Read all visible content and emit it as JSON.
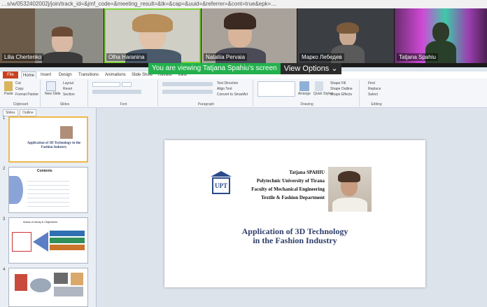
{
  "browser": {
    "url": "…s/w/0532402002j/join/track_id=&jmf_code=&meeting_result=&tk=&cap=&uuid=&referrer=&cont=true&epk=…"
  },
  "gallery": {
    "participants": [
      {
        "name": "Lilia Chertenko"
      },
      {
        "name": "Olha Haranina"
      },
      {
        "name": "Nataliia Pervaia"
      },
      {
        "name": "Марко Лебедев"
      },
      {
        "name": "Tatjana Spahiu"
      }
    ]
  },
  "share_banner": {
    "message": "You are viewing Tatjana Spahiu's screen",
    "options_label": "View Options"
  },
  "ribbon": {
    "file_tab": "File",
    "tabs": [
      "Home",
      "Insert",
      "Design",
      "Transitions",
      "Animations",
      "Slide Show",
      "Review",
      "View"
    ],
    "groups": [
      "Clipboard",
      "Slides",
      "Font",
      "Paragraph",
      "Drawing",
      "Editing"
    ],
    "clipboard": {
      "paste": "Paste",
      "cut": "Cut",
      "copy": "Copy",
      "format_painter": "Format Painter"
    },
    "slides": {
      "new_slide": "New Slide",
      "layout": "Layout",
      "reset": "Reset",
      "section": "Section"
    },
    "paragraph": {
      "text_direction": "Text Direction",
      "align_text": "Align Text",
      "convert": "Convert to SmartArt"
    },
    "drawing": {
      "arrange": "Arrange",
      "quick_styles": "Quick Styles",
      "shape_fill": "Shape Fill",
      "shape_outline": "Shape Outline",
      "shape_effects": "Shape Effects"
    },
    "editing": {
      "find": "Find",
      "replace": "Replace",
      "select": "Select"
    }
  },
  "slides_panel": {
    "tabs": [
      "Slides",
      "Outline"
    ],
    "thumbnails": [
      {
        "number": "1",
        "title": "Application of 3D Technology in the Fashion Industry"
      },
      {
        "number": "2",
        "title": "Contents"
      },
      {
        "number": "3",
        "title": "Areas of study & Objectives"
      },
      {
        "number": "4",
        "title": ""
      }
    ]
  },
  "slide": {
    "logo_text": "UPT",
    "author": "Tatjana SPAHIU",
    "university": "Polytechnic University of Tirana",
    "faculty": "Faculty of Mechanical Engineering",
    "department": "Textile & Fashion Department",
    "title_line1": "Application of 3D Technology",
    "title_line2": "in the Fashion Industry"
  },
  "colors": {
    "share_green": "#23b14d",
    "file_tab": "#c8421f",
    "title_blue": "#2e3d6a",
    "logo_blue": "#2b4a8a",
    "active_speaker": "#7fd13b"
  }
}
